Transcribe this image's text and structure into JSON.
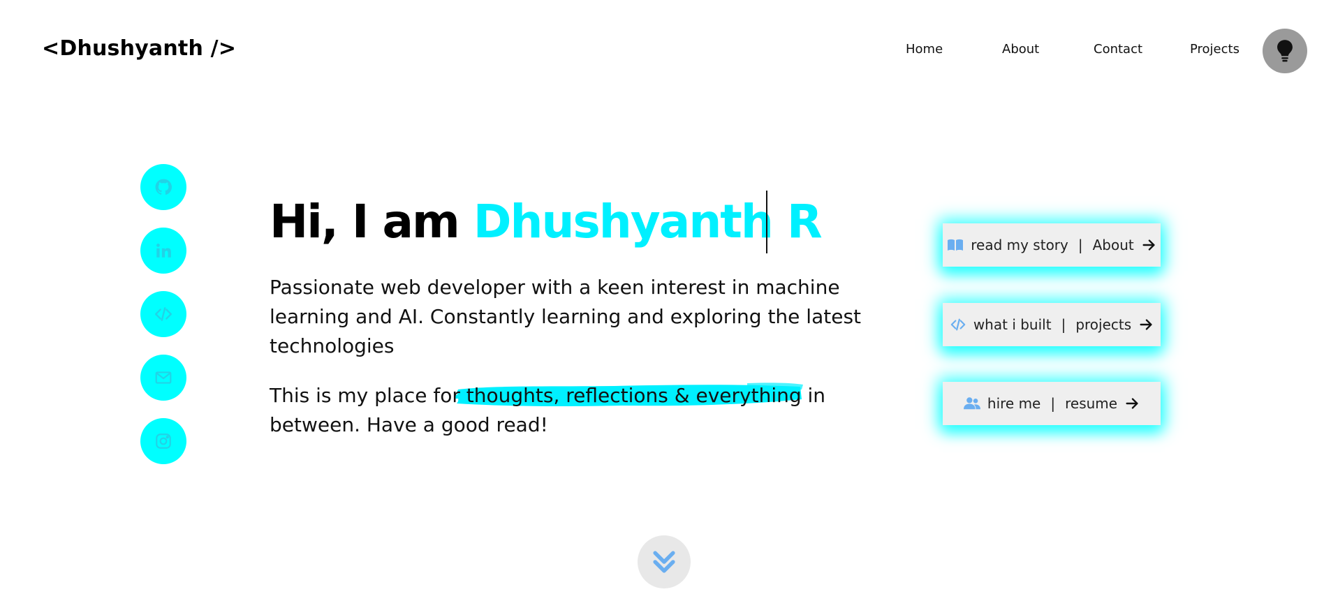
{
  "header": {
    "logo": "<Dhushyanth />",
    "nav": [
      {
        "label": "Home"
      },
      {
        "label": "About"
      },
      {
        "label": "Contact"
      },
      {
        "label": "Projects"
      }
    ],
    "theme_toggle_icon": "lightbulb-icon"
  },
  "social": [
    {
      "icon": "github-icon"
    },
    {
      "icon": "linkedin-icon"
    },
    {
      "icon": "code-icon"
    },
    {
      "icon": "mail-icon"
    },
    {
      "icon": "instagram-icon"
    }
  ],
  "hero": {
    "greeting": "Hi, I am ",
    "name": "Dhushyanth R",
    "intro": "Passionate web developer with a keen interest in machine learning and AI. Constantly learning and exploring the latest technologies",
    "place_before": "This is my place for ",
    "place_highlight": "thoughts, reflections & everything in",
    "place_after": " between. Have a good read!"
  },
  "cta": [
    {
      "icon": "book-icon",
      "left": "read my story",
      "sep": "|",
      "right": "About"
    },
    {
      "icon": "code-icon",
      "left": "what i built",
      "sep": "|",
      "right": "projects"
    },
    {
      "icon": "users-icon",
      "left": "hire me",
      "sep": "|",
      "right": "resume"
    }
  ],
  "colors": {
    "accent": "#00ffff",
    "name": "#00f0ff",
    "icon_blue": "#6aaef0",
    "toggle_bg": "#9a9a9a"
  },
  "scroll_icon": "chevrons-down-icon"
}
